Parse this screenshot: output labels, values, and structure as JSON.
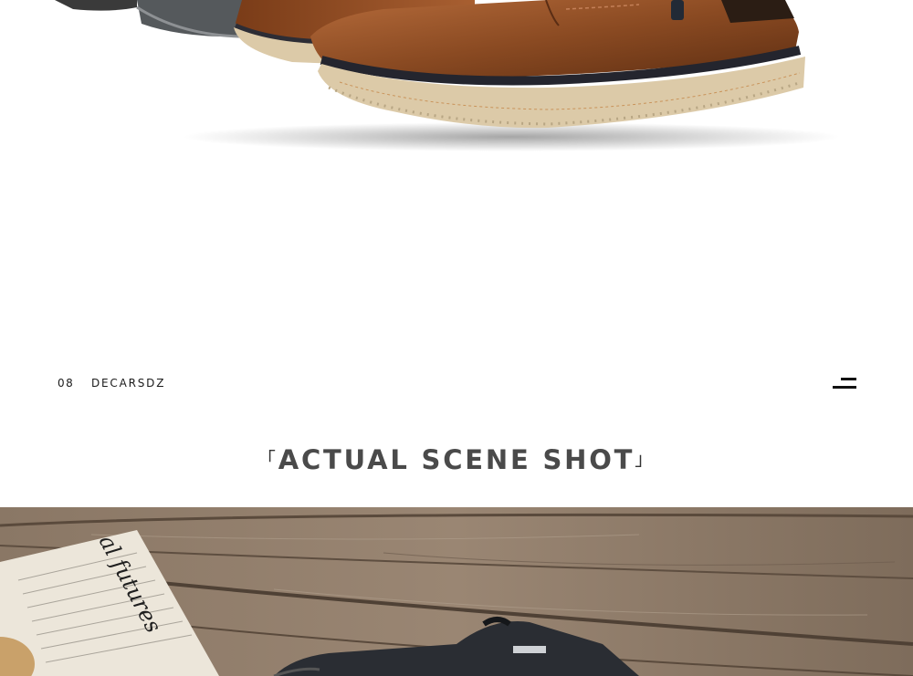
{
  "hero": {
    "image_alt": "brown leather boots"
  },
  "section": {
    "number": "08",
    "brand": "DECARSDZ",
    "menu_icon": "hamburger-menu-icon"
  },
  "headline": {
    "open_bracket": "「",
    "text": "ACTUAL SCENE SHOT",
    "close_bracket": "」"
  },
  "scene": {
    "newspaper_text": "al futures"
  },
  "colors": {
    "background": "#ffffff",
    "headline": "#4a4a4a",
    "leather": "#8a4a22",
    "sole": "#dccaa8",
    "wood": "#8c7a67"
  }
}
